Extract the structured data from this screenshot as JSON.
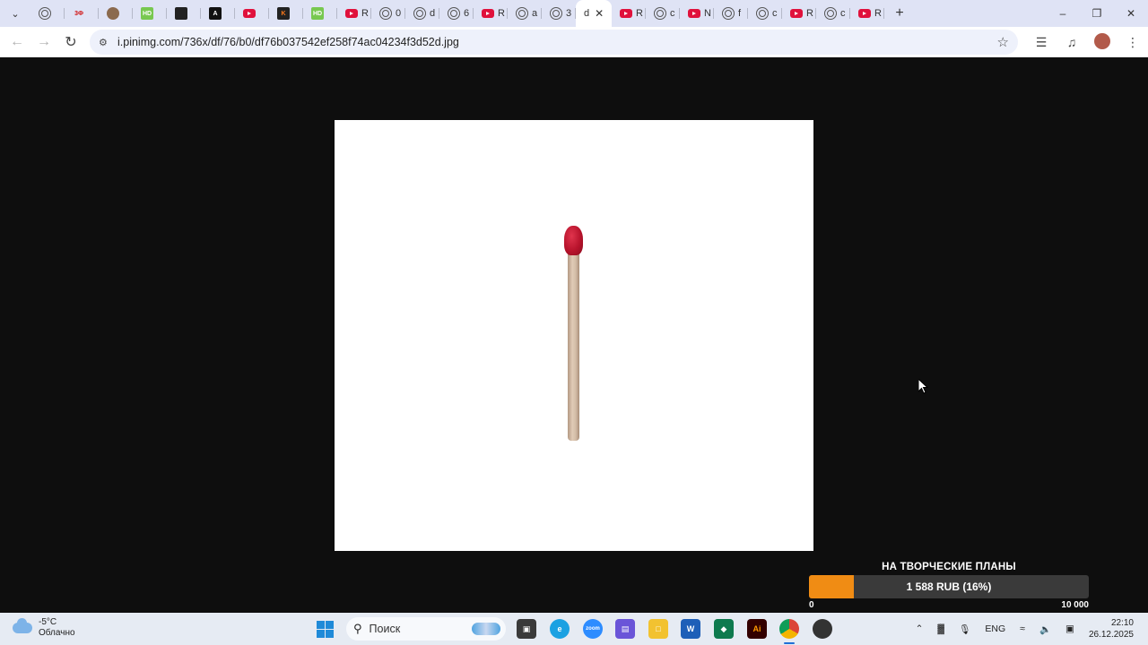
{
  "browser": {
    "tabs": [
      {
        "icon": "globe-icon",
        "label": ""
      },
      {
        "icon": "text-favicon",
        "label": "",
        "text": "3Ф",
        "color": "#d01010",
        "bg": "#dfe3f5"
      },
      {
        "icon": "avatar-favicon",
        "label": ""
      },
      {
        "icon": "text-favicon",
        "label": "",
        "text": "HD",
        "color": "#ffffff",
        "bg": "#78c850"
      },
      {
        "icon": "film-favicon",
        "label": ""
      },
      {
        "icon": "text-favicon",
        "label": "",
        "text": "A",
        "color": "#ffffff",
        "bg": "#111111"
      },
      {
        "icon": "youtube-icon",
        "label": ""
      },
      {
        "icon": "text-favicon",
        "label": "",
        "text": "K",
        "color": "#ff7a1a",
        "bg": "#222222"
      },
      {
        "icon": "text-favicon",
        "label": "",
        "text": "HD",
        "color": "#ffffff",
        "bg": "#78c850"
      },
      {
        "icon": "youtube-icon",
        "label": "R"
      },
      {
        "icon": "globe-icon",
        "label": "0"
      },
      {
        "icon": "globe-icon",
        "label": "d"
      },
      {
        "icon": "globe-icon",
        "label": "6"
      },
      {
        "icon": "youtube-icon",
        "label": "R"
      },
      {
        "icon": "globe-icon",
        "label": "a"
      },
      {
        "icon": "globe-icon",
        "label": "3"
      },
      {
        "icon": "active",
        "label": "d",
        "active": true
      },
      {
        "icon": "youtube-icon",
        "label": "R"
      },
      {
        "icon": "globe-icon",
        "label": "c"
      },
      {
        "icon": "youtube-icon",
        "label": "N"
      },
      {
        "icon": "globe-icon",
        "label": "f"
      },
      {
        "icon": "globe-icon",
        "label": "c"
      },
      {
        "icon": "youtube-icon",
        "label": "R"
      },
      {
        "icon": "globe-icon",
        "label": "c"
      },
      {
        "icon": "youtube-icon",
        "label": "R"
      }
    ],
    "url": "i.pinimg.com/736x/df/76/b0/df76b037542ef258f74ac04234f3d52d.jpg"
  },
  "donation": {
    "title": "НА ТВОРЧЕСКИЕ ПЛАНЫ",
    "amount_text": "1 588 RUB (16%)",
    "progress": 0.16,
    "min_label": "0",
    "max_label": "10 000"
  },
  "taskbar": {
    "temperature": "-5°C",
    "condition": "Облачно",
    "search_placeholder": "Поиск",
    "language": "ENG",
    "time": "22:10",
    "date": "26.12.2025"
  },
  "colors": {
    "tabstrip_bg": "#dfe3f5",
    "viewer_bg": "#0e0e0e",
    "progress_fill": "#f08c14",
    "match_head": "#b8132c"
  }
}
